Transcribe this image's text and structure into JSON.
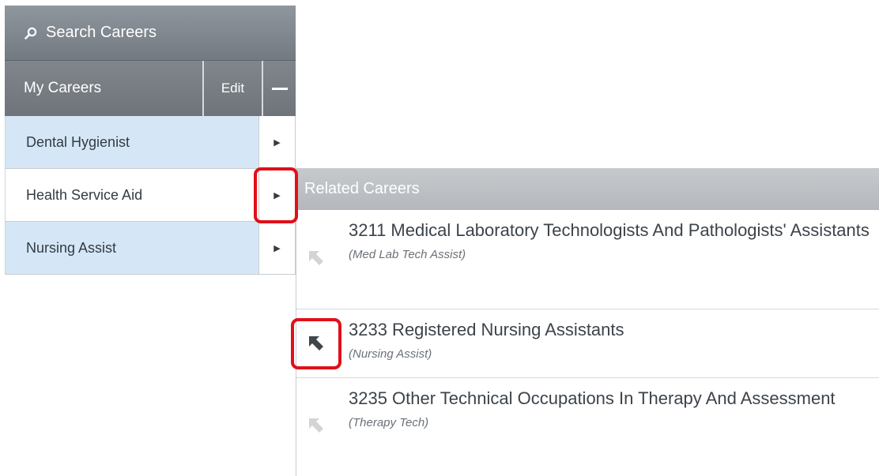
{
  "sidebar": {
    "search_label": "Search Careers",
    "my_careers_label": "My Careers",
    "edit_label": "Edit",
    "careers": [
      {
        "label": "Dental Hygienist"
      },
      {
        "label": "Health Service Aid"
      },
      {
        "label": "Nursing Assist"
      }
    ]
  },
  "related": {
    "header": "Related Careers",
    "items": [
      {
        "title": "3211 Medical Laboratory Technologists And Pathologists' Assistants",
        "alt": "(Med Lab Tech Assist)"
      },
      {
        "title": "3233 Registered Nursing Assistants",
        "alt": "(Nursing Assist)"
      },
      {
        "title": "3235 Other Technical Occupations In Therapy And Assessment",
        "alt": "(Therapy Tech)"
      }
    ]
  },
  "colors": {
    "selected_item_bg": "#d5e7f6",
    "highlight_box": "#e0101a",
    "header_gray": "#737a81"
  }
}
